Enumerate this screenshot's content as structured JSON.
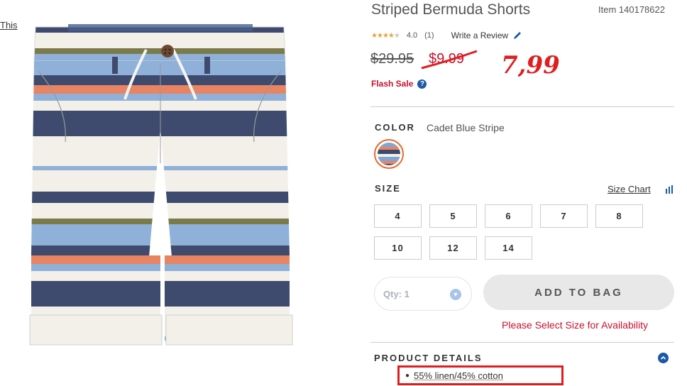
{
  "left_link": "This",
  "product": {
    "title": "Striped Bermuda Shorts",
    "item_number": "Item 140178622",
    "rating_value": "4.0",
    "review_count": "(1)",
    "rating": 4,
    "rating_max": 5,
    "write_review": "Write a Review",
    "original_price": "$29.95",
    "sale_price": "$9.99",
    "handwritten_price": "7,99",
    "flash_sale": "Flash Sale",
    "help_icon": "?"
  },
  "color": {
    "label": "COLOR",
    "value": "Cadet Blue Stripe"
  },
  "size": {
    "label": "SIZE",
    "chart_link": "Size Chart",
    "options": [
      "4",
      "5",
      "6",
      "7",
      "8",
      "10",
      "12",
      "14"
    ]
  },
  "purchase": {
    "qty_label": "Qty: 1",
    "add_to_bag": "ADD TO BAG",
    "availability_message": "Please Select Size for Availability"
  },
  "details": {
    "label": "PRODUCT DETAILS",
    "items": [
      "55% linen/45% cotton"
    ]
  },
  "colors": {
    "sale_red": "#c8102e",
    "annotation_red": "#e01e1e",
    "accent_blue": "#1b5aa6"
  },
  "icons": {
    "pencil": "pencil-icon",
    "help": "help-icon",
    "size_chart": "bar-chart-icon",
    "qty": "chevron-down-icon",
    "collapse": "chevron-up-icon"
  }
}
